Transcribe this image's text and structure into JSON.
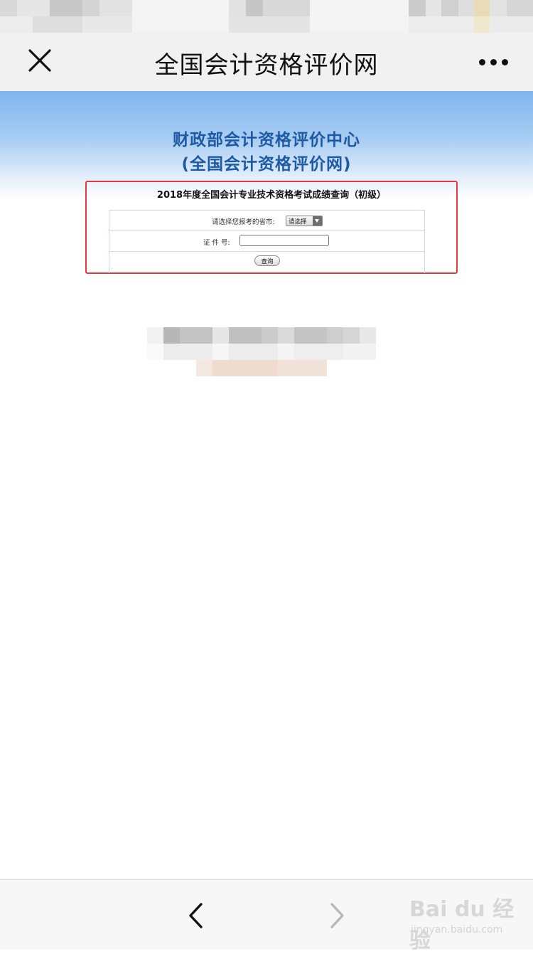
{
  "nav": {
    "title": "全国会计资格评价网",
    "close_icon": "close-icon",
    "more_icon": "more-dots-icon"
  },
  "banner": {
    "line1": "财政部会计资格评价中心",
    "line2": "(全国会计资格评价网)"
  },
  "form": {
    "title": "2018年度全国会计专业技术资格考试成绩查询（初级）",
    "province_label": "请选择您报考的省市:",
    "province_select_value": "请选择",
    "id_label": "证 件 号:",
    "id_value": "",
    "query_label": "查询"
  },
  "toolbar": {
    "back_icon": "chevron-left-icon",
    "forward_icon": "chevron-right-icon"
  },
  "watermark": {
    "main": "Bai du 经验",
    "sub": "jingyan.baidu.com"
  },
  "colors": {
    "banner_text": "#1d5aa3",
    "highlight_border": "#e23b3b",
    "nav_bg": "#f1f1f1"
  }
}
